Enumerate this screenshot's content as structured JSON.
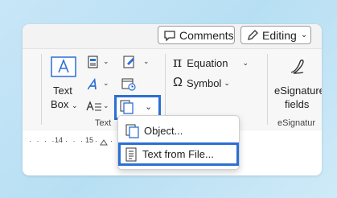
{
  "topbar": {
    "comments_label": "Comments",
    "editing_label": "Editing"
  },
  "ribbon": {
    "textbox_label_line1": "Text",
    "textbox_label_line2": "Box",
    "text_group_label": "Text",
    "equation_label": "Equation",
    "symbol_label": "Symbol",
    "esignature_line1": "eSignature",
    "esignature_line2": "fields",
    "esignature_group_label": "eSignatur"
  },
  "ruler": {
    "marks": [
      "14",
      "15"
    ]
  },
  "menu": {
    "items": [
      {
        "label": "Object..."
      },
      {
        "label": "Text from File..."
      }
    ]
  },
  "colors": {
    "highlight": "#2b6fd6",
    "icon_blue": "#2b6fd6"
  }
}
